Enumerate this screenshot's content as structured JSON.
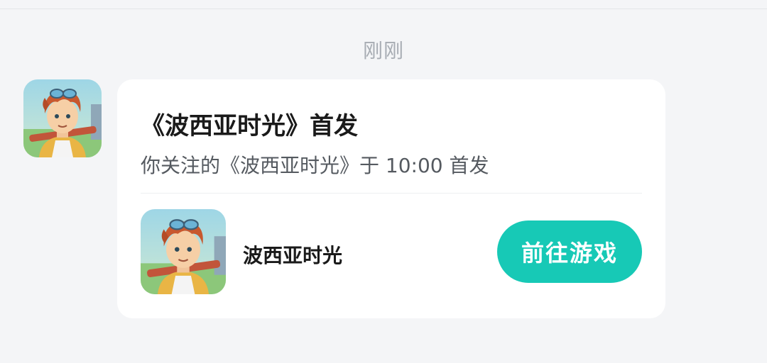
{
  "message": {
    "timestamp": "刚刚",
    "title": "《波西亚时光》首发",
    "subtitle": "你关注的《波西亚时光》于 10:00 首发",
    "game_name": "波西亚时光",
    "action_label": "前往游戏",
    "accent_color": "#17c9b6"
  },
  "icons": {
    "sender_avatar": "game-character-icon",
    "game_icon": "game-character-icon"
  }
}
